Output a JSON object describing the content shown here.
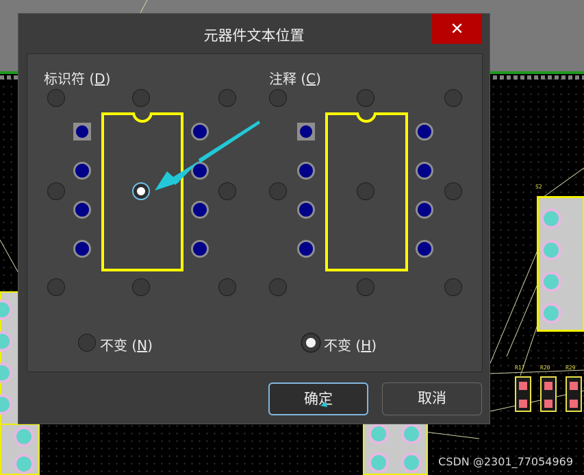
{
  "dialog": {
    "title": "元器件文本位置",
    "close_icon": "close-icon",
    "close_glyph": "✕"
  },
  "designator": {
    "label": "标识符",
    "hotkey": "D",
    "no_change_label": "不变",
    "no_change_hotkey": "N",
    "selected": "center"
  },
  "comment": {
    "label": "注释",
    "hotkey": "C",
    "no_change_label": "不变",
    "no_change_hotkey": "H",
    "selected": "no_change"
  },
  "buttons": {
    "ok": "确定",
    "cancel": "取消"
  },
  "background": {
    "s2_label": "S2",
    "resistors": [
      "R17",
      "R20",
      "R29"
    ],
    "watermark": "CSDN @2301_77054969"
  },
  "colors": {
    "chip_outline": "#ffff00",
    "pin_fill": "#000088",
    "close_button": "#b80000",
    "annotation_arrow": "#22c8d8"
  }
}
